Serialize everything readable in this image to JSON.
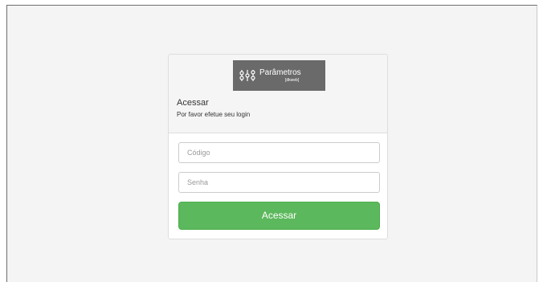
{
  "logo": {
    "name": "Parâmetros",
    "subtitle": "[dkweb]",
    "icon": "equalizer-sliders-icon"
  },
  "login": {
    "title": "Acessar",
    "subtitle": "Por favor efetue seu login",
    "code_placeholder": "Código",
    "password_placeholder": "Senha",
    "submit_label": "Acessar"
  },
  "colors": {
    "page_background": "#f4f4f4",
    "logo_background": "#6a6a6a",
    "submit_background": "#5cb85c"
  }
}
